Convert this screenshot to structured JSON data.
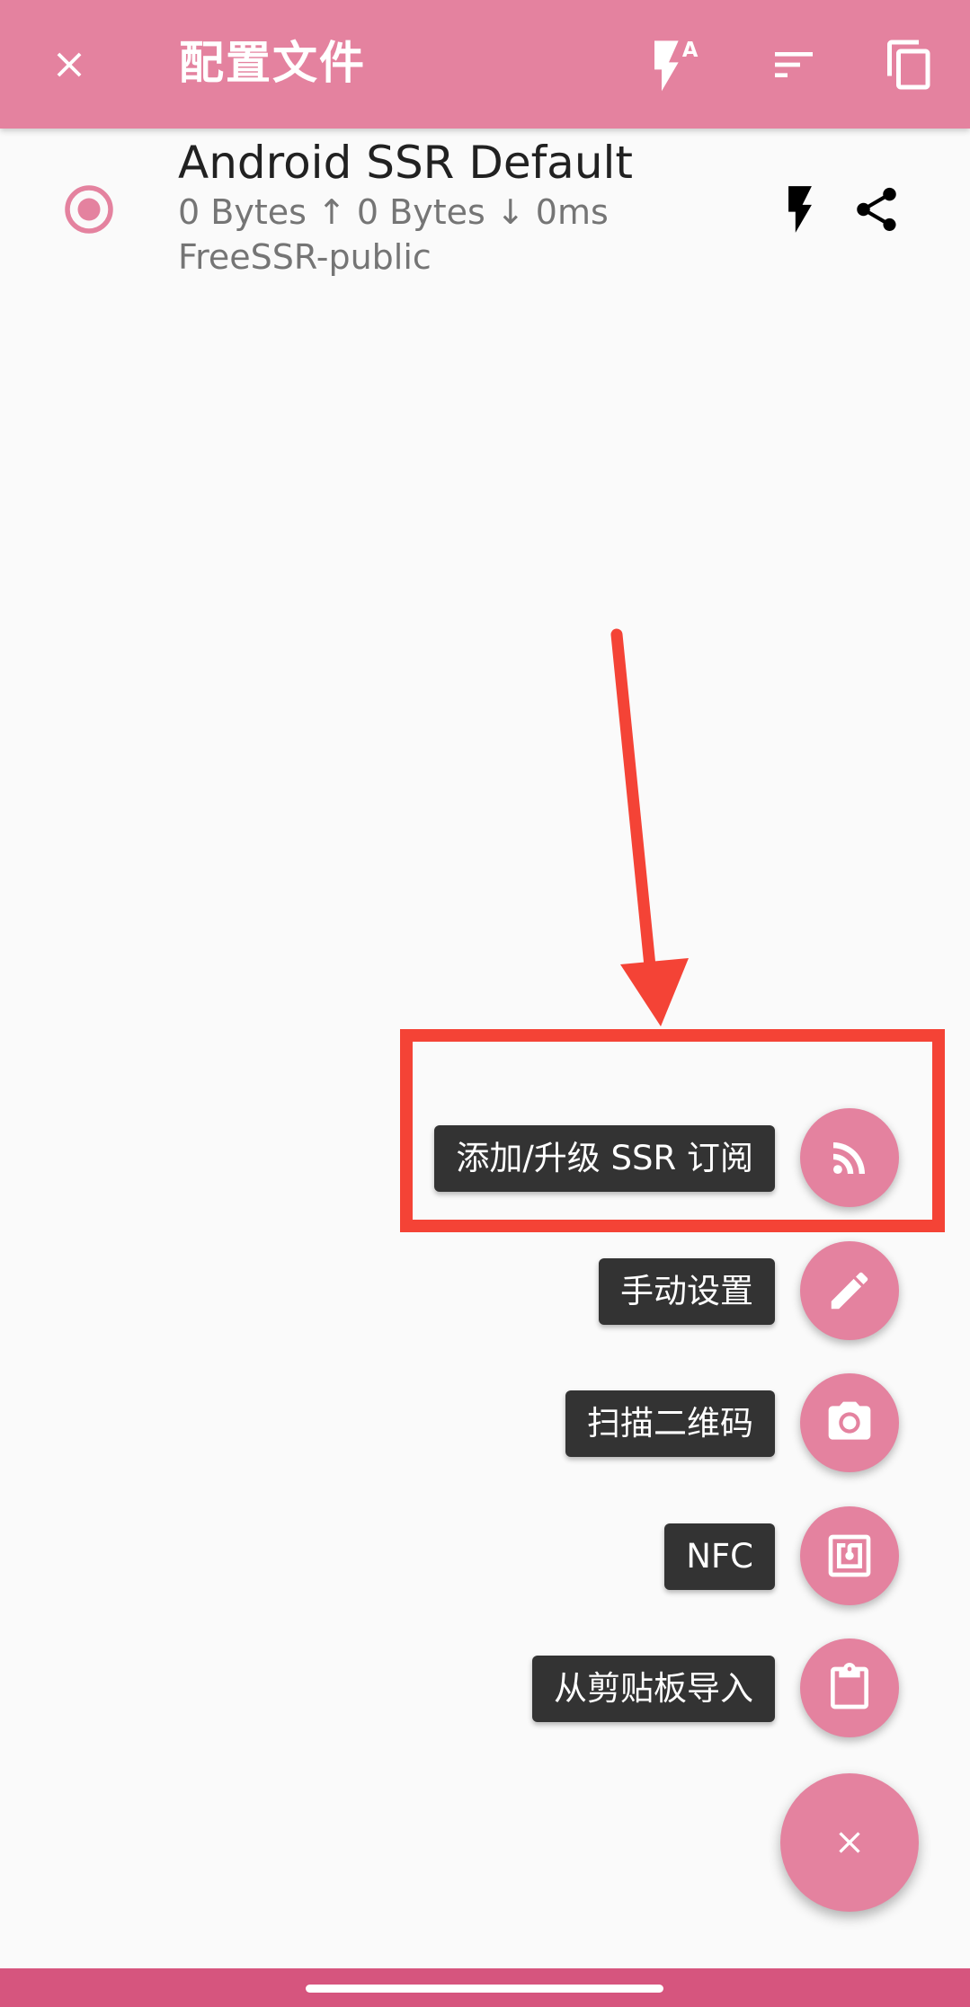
{
  "app_bar": {
    "title": "配置文件",
    "close_icon": "close-icon",
    "test_all_icon": "flash-auto-icon",
    "sort_icon": "sort-icon",
    "copy_icon": "copy-icon"
  },
  "profile": {
    "name": "Android SSR Default",
    "traffic": "0 Bytes ↑ 0 Bytes ↓ 0ms",
    "group": "FreeSSR-public",
    "selected": true,
    "test_icon": "flash-icon",
    "share_icon": "share-icon"
  },
  "speed_dial": {
    "items": [
      {
        "label": "添加/升级 SSR 订阅",
        "icon": "rss-feed-icon"
      },
      {
        "label": "手动设置",
        "icon": "pencil-icon"
      },
      {
        "label": "扫描二维码",
        "icon": "camera-icon"
      },
      {
        "label": "NFC",
        "icon": "nfc-icon"
      },
      {
        "label": "从剪贴板导入",
        "icon": "clipboard-icon"
      }
    ],
    "close_icon": "close-icon"
  },
  "colors": {
    "accent": "#e4829f",
    "nav_bar": "#d6557e",
    "annotation": "#f44336",
    "label_bg": "#333333"
  }
}
